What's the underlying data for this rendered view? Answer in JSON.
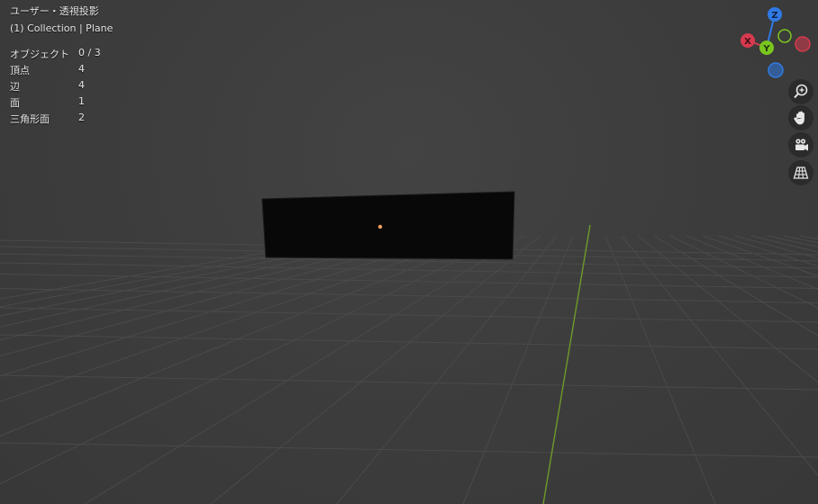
{
  "viewport": {
    "view_name": "ユーザー・透視投影",
    "collection_label": "(1) Collection | Plane",
    "stats": [
      {
        "label": "オブジェクト",
        "value": "0 / 3"
      },
      {
        "label": "頂点",
        "value": "4"
      },
      {
        "label": "辺",
        "value": "4"
      },
      {
        "label": "面",
        "value": "1"
      },
      {
        "label": "三角形面",
        "value": "2"
      }
    ]
  },
  "gizmo": {
    "axes": [
      {
        "label": "Z",
        "color": "#2f7ae5"
      },
      {
        "label": "X",
        "color": "#d63a4e"
      },
      {
        "label": "Y",
        "color": "#7ac51e"
      }
    ]
  },
  "navigation": {
    "buttons": [
      {
        "name": "zoom-icon"
      },
      {
        "name": "hand-pan-icon"
      },
      {
        "name": "camera-view-icon"
      },
      {
        "name": "perspective-grid-icon"
      }
    ]
  },
  "colors": {
    "background": "#3d3d3d",
    "grid_line": "#4a4a4a",
    "y_axis_line": "#6e9a2c",
    "plane_fill": "#080808",
    "origin_point": "#f0a060"
  }
}
